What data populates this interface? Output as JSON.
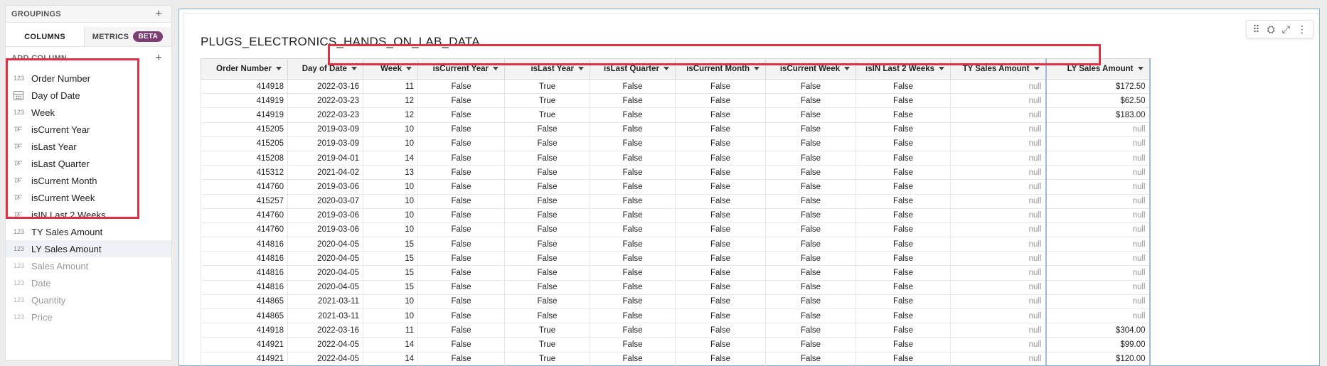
{
  "left_panel": {
    "groupings_label": "GROUPINGS",
    "tabs": [
      {
        "label": "COLUMNS",
        "active": true
      },
      {
        "label": "METRICS",
        "active": false,
        "badge": "BETA"
      }
    ],
    "add_column_label": "ADD COLUMN",
    "columns": [
      {
        "name": "Order Number",
        "type": "number-icon",
        "type_glyph": "123",
        "included": true
      },
      {
        "name": "Day of Date",
        "type": "calendar-icon",
        "type_glyph": "",
        "included": true
      },
      {
        "name": "Week",
        "type": "number-icon",
        "type_glyph": "123",
        "included": true
      },
      {
        "name": "isCurrent Year",
        "type": "boolean-icon",
        "type_glyph": "T/F",
        "included": true
      },
      {
        "name": "isLast Year",
        "type": "boolean-icon",
        "type_glyph": "T/F",
        "included": true
      },
      {
        "name": "isLast Quarter",
        "type": "boolean-icon",
        "type_glyph": "T/F",
        "included": true
      },
      {
        "name": "isCurrent Month",
        "type": "boolean-icon",
        "type_glyph": "T/F",
        "included": true
      },
      {
        "name": "isCurrent Week",
        "type": "boolean-icon",
        "type_glyph": "T/F",
        "included": true
      },
      {
        "name": "isIN Last 2 Weeks",
        "type": "boolean-icon",
        "type_glyph": "T/F",
        "included": true
      },
      {
        "name": "TY Sales Amount",
        "type": "number-icon",
        "type_glyph": "123",
        "included": true
      },
      {
        "name": "LY Sales Amount",
        "type": "number-icon",
        "type_glyph": "123",
        "included": true,
        "selected": true
      },
      {
        "name": "Sales Amount",
        "type": "number-icon",
        "type_glyph": "123",
        "included": false
      },
      {
        "name": "Date",
        "type": "number-icon",
        "type_glyph": "123",
        "included": false
      },
      {
        "name": "Quantity",
        "type": "number-icon",
        "type_glyph": "123",
        "included": false
      },
      {
        "name": "Price",
        "type": "number-icon",
        "type_glyph": "123",
        "included": false
      }
    ]
  },
  "main": {
    "title": "PLUGS_ELECTRONICS_HANDS_ON_LAB_DATA",
    "toolbar_icons": [
      "drag-handle-icon",
      "chart-settings-icon",
      "expand-icon",
      "more-icon"
    ],
    "table": {
      "headers": [
        "Order Number",
        "Day of Date",
        "Week",
        "isCurrent Year",
        "isLast Year",
        "isLast Quarter",
        "isCurrent Month",
        "isCurrent Week",
        "isIN Last 2 Weeks",
        "TY Sales Amount",
        "LY Sales Amount"
      ],
      "rows": [
        [
          "414918",
          "2022-03-16",
          "11",
          "False",
          "True",
          "False",
          "False",
          "False",
          "False",
          "null",
          "$172.50"
        ],
        [
          "414919",
          "2022-03-23",
          "12",
          "False",
          "True",
          "False",
          "False",
          "False",
          "False",
          "null",
          "$62.50"
        ],
        [
          "414919",
          "2022-03-23",
          "12",
          "False",
          "True",
          "False",
          "False",
          "False",
          "False",
          "null",
          "$183.00"
        ],
        [
          "415205",
          "2019-03-09",
          "10",
          "False",
          "False",
          "False",
          "False",
          "False",
          "False",
          "null",
          "null"
        ],
        [
          "415205",
          "2019-03-09",
          "10",
          "False",
          "False",
          "False",
          "False",
          "False",
          "False",
          "null",
          "null"
        ],
        [
          "415208",
          "2019-04-01",
          "14",
          "False",
          "False",
          "False",
          "False",
          "False",
          "False",
          "null",
          "null"
        ],
        [
          "415312",
          "2021-04-02",
          "13",
          "False",
          "False",
          "False",
          "False",
          "False",
          "False",
          "null",
          "null"
        ],
        [
          "414760",
          "2019-03-06",
          "10",
          "False",
          "False",
          "False",
          "False",
          "False",
          "False",
          "null",
          "null"
        ],
        [
          "415257",
          "2020-03-07",
          "10",
          "False",
          "False",
          "False",
          "False",
          "False",
          "False",
          "null",
          "null"
        ],
        [
          "414760",
          "2019-03-06",
          "10",
          "False",
          "False",
          "False",
          "False",
          "False",
          "False",
          "null",
          "null"
        ],
        [
          "414760",
          "2019-03-06",
          "10",
          "False",
          "False",
          "False",
          "False",
          "False",
          "False",
          "null",
          "null"
        ],
        [
          "414816",
          "2020-04-05",
          "15",
          "False",
          "False",
          "False",
          "False",
          "False",
          "False",
          "null",
          "null"
        ],
        [
          "414816",
          "2020-04-05",
          "15",
          "False",
          "False",
          "False",
          "False",
          "False",
          "False",
          "null",
          "null"
        ],
        [
          "414816",
          "2020-04-05",
          "15",
          "False",
          "False",
          "False",
          "False",
          "False",
          "False",
          "null",
          "null"
        ],
        [
          "414816",
          "2020-04-05",
          "15",
          "False",
          "False",
          "False",
          "False",
          "False",
          "False",
          "null",
          "null"
        ],
        [
          "414865",
          "2021-03-11",
          "10",
          "False",
          "False",
          "False",
          "False",
          "False",
          "False",
          "null",
          "null"
        ],
        [
          "414865",
          "2021-03-11",
          "10",
          "False",
          "False",
          "False",
          "False",
          "False",
          "False",
          "null",
          "null"
        ],
        [
          "414918",
          "2022-03-16",
          "11",
          "False",
          "True",
          "False",
          "False",
          "False",
          "False",
          "null",
          "$304.00"
        ],
        [
          "414921",
          "2022-04-05",
          "14",
          "False",
          "True",
          "False",
          "False",
          "False",
          "False",
          "null",
          "$99.00"
        ],
        [
          "414921",
          "2022-04-05",
          "14",
          "False",
          "True",
          "False",
          "False",
          "False",
          "False",
          "null",
          "$120.00"
        ]
      ]
    }
  },
  "colors": {
    "highlight_red": "#e03044",
    "beta_badge": "#7b3d72",
    "selected_border": "#9bbcd8"
  }
}
